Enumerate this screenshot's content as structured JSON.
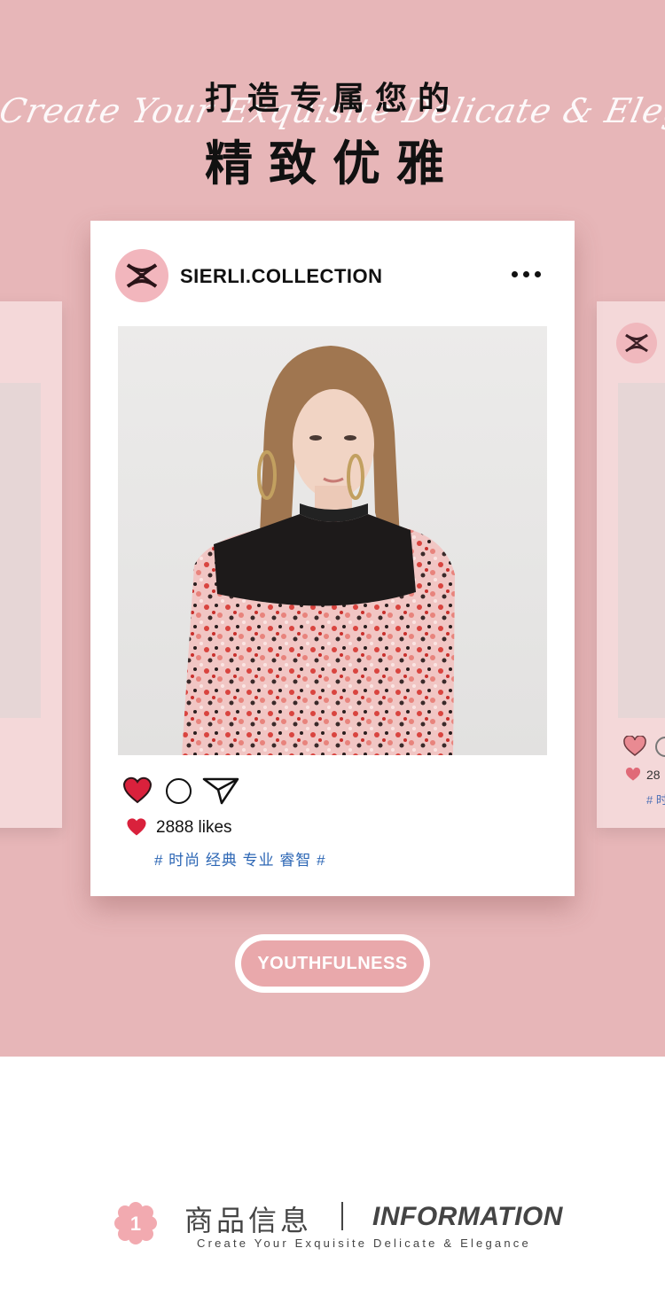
{
  "header": {
    "script_line": "Create Your Exquisite Delicate & Elegance",
    "cn_top": "打造专属您的",
    "cn_main": "精致优雅"
  },
  "post": {
    "brand": "SIERLI.COLLECTION",
    "likes": "2888 likes",
    "tags": "# 时尚 经典 专业 睿智 #"
  },
  "side_right": {
    "likes": "28",
    "tags": "# 时"
  },
  "cta": {
    "label": "YOUTHFULNESS"
  },
  "info": {
    "badge": "1",
    "cn": "商品信息",
    "en": "INFORMATION",
    "sub": "Create Your Exquisite Delicate & Elegance"
  },
  "colors": {
    "hero_bg": "#e7b6b8",
    "side_card": "#f4d8d9",
    "avatar_bg": "#f2b6bd",
    "heart": "#d9213c",
    "tag_blue": "#2d67b5",
    "pill": "#e9a8ab"
  },
  "icons": [
    "more-icon",
    "heart-icon",
    "comment-icon",
    "send-icon",
    "flower-badge-icon",
    "logo-icon"
  ]
}
